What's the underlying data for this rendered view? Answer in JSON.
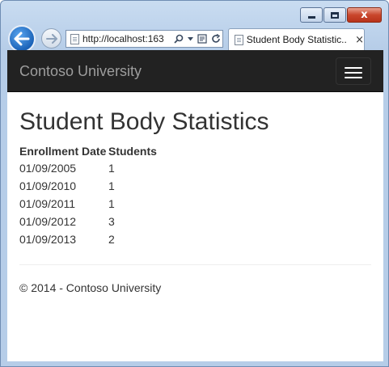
{
  "browser": {
    "address": "http://localhost:163",
    "tab_title": "Student Body Statistic...",
    "tab_close": "×",
    "controls": {
      "minimize": "",
      "maximize": "",
      "close": "x"
    }
  },
  "navbar": {
    "brand": "Contoso University"
  },
  "page": {
    "title": "Student Body Statistics",
    "table": {
      "headers": [
        "Enrollment Date",
        "Students"
      ],
      "rows": [
        [
          "01/09/2005",
          "1"
        ],
        [
          "01/09/2010",
          "1"
        ],
        [
          "01/09/2011",
          "1"
        ],
        [
          "01/09/2012",
          "3"
        ],
        [
          "01/09/2013",
          "2"
        ]
      ]
    },
    "footer": "© 2014 - Contoso University"
  },
  "icons": [
    "back-arrow-icon",
    "forward-arrow-icon",
    "page-icon",
    "search-icon",
    "dropdown-icon",
    "compat-view-icon",
    "refresh-icon",
    "hamburger-icon"
  ],
  "colors": {
    "navbar": "#222222",
    "brand": "#9d9d9d",
    "text": "#333333",
    "back_button": "#1b63b8"
  }
}
